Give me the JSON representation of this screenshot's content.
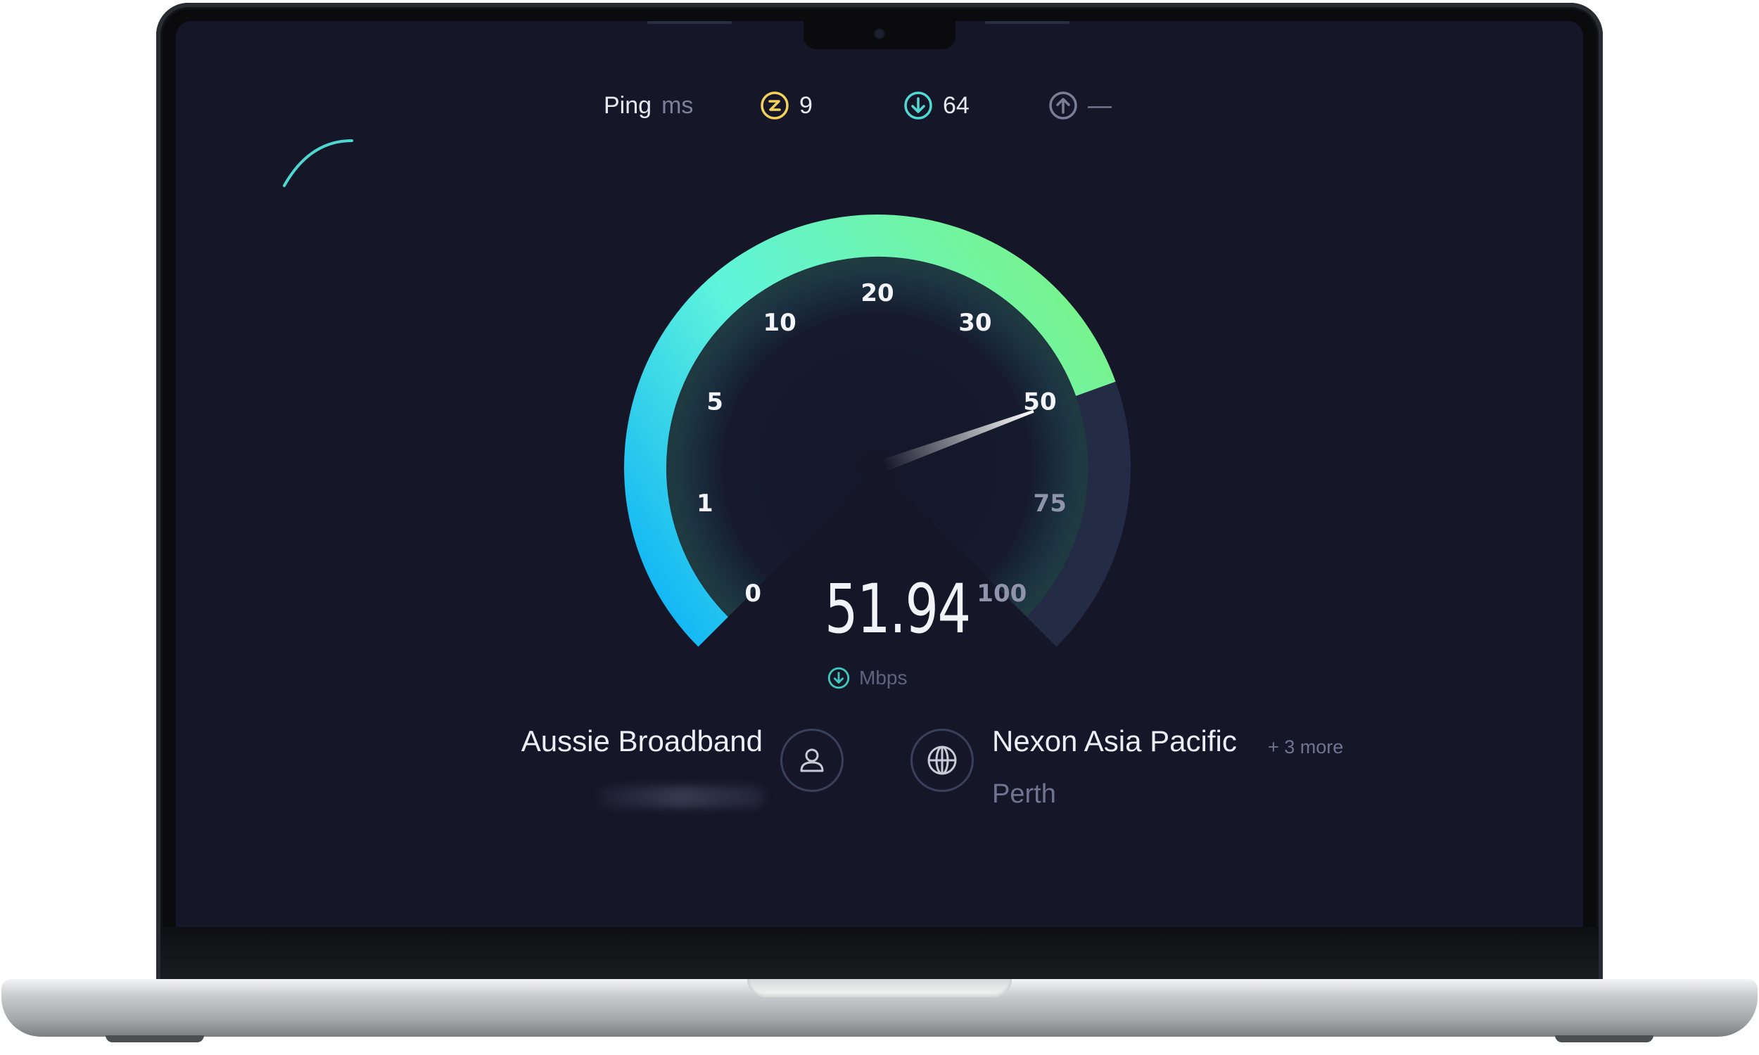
{
  "stats": {
    "ping_label": "Ping",
    "ping_unit": "ms",
    "jitter_value": "9",
    "download_value": "64",
    "upload_value": "—"
  },
  "gauge": {
    "ticks": [
      "0",
      "1",
      "5",
      "10",
      "20",
      "30",
      "50",
      "75",
      "100"
    ],
    "current_value": "51.94",
    "unit": "Mbps",
    "needle_value": 51.94,
    "colors": {
      "arc_start": "#12b6f5",
      "arc_mid": "#5ff5dc",
      "arc_end": "#78f38c",
      "arc_remaining": "#232b45",
      "background": "#151729"
    }
  },
  "isp": {
    "name": "Aussie Broadband"
  },
  "server": {
    "name": "Nexon Asia Pacific",
    "more": "+ 3 more",
    "city": "Perth"
  }
}
